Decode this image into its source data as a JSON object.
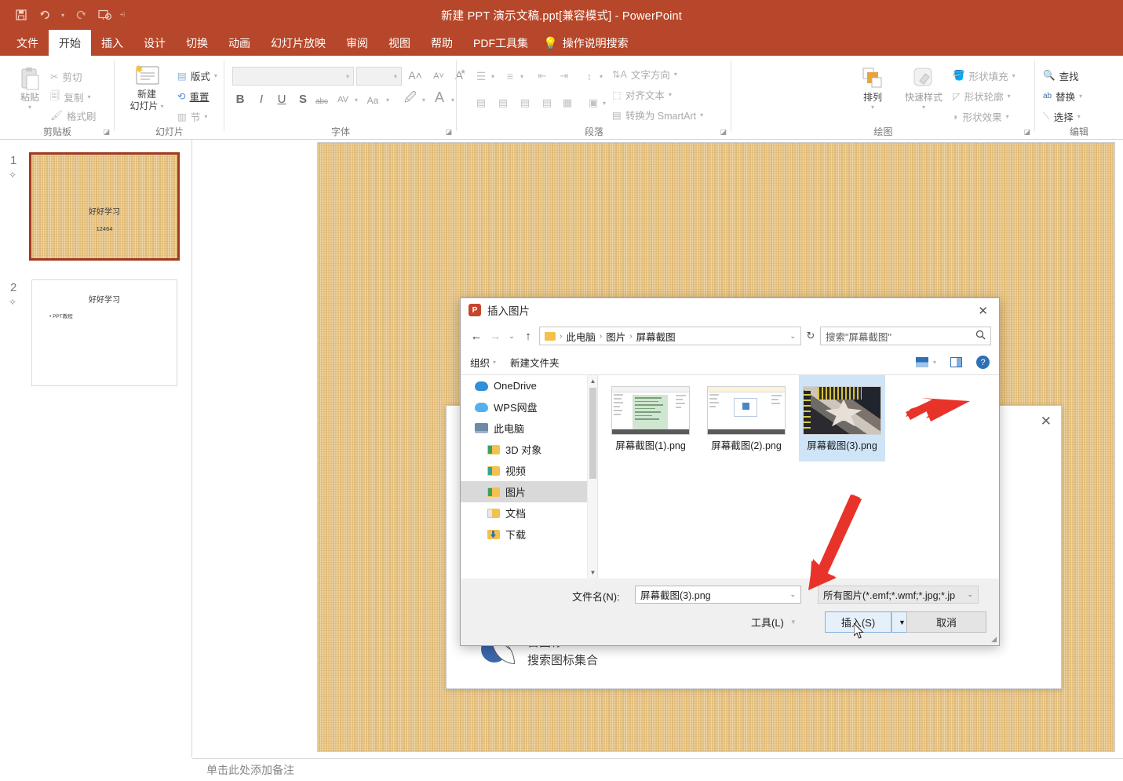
{
  "app": {
    "title": "新建 PPT 演示文稿.ppt[兼容模式]  -  PowerPoint",
    "accent": "#b7472a"
  },
  "quick_access": [
    {
      "name": "save",
      "glyph": "🖫"
    },
    {
      "name": "undo",
      "glyph": "↺"
    },
    {
      "name": "redo",
      "glyph": "↻"
    },
    {
      "name": "start-slideshow",
      "glyph": "🖵"
    }
  ],
  "tabs": [
    {
      "label": "文件",
      "active": false
    },
    {
      "label": "开始",
      "active": true
    },
    {
      "label": "插入",
      "active": false
    },
    {
      "label": "设计",
      "active": false
    },
    {
      "label": "切换",
      "active": false
    },
    {
      "label": "动画",
      "active": false
    },
    {
      "label": "幻灯片放映",
      "active": false
    },
    {
      "label": "审阅",
      "active": false
    },
    {
      "label": "视图",
      "active": false
    },
    {
      "label": "帮助",
      "active": false
    },
    {
      "label": "PDF工具集",
      "active": false
    }
  ],
  "tell_me": "操作说明搜索",
  "ribbon": {
    "clipboard": {
      "title": "剪贴板",
      "paste": "粘贴",
      "cut": "剪切",
      "copy": "复制",
      "format_painter": "格式刷"
    },
    "slides": {
      "title": "幻灯片",
      "new_slide": "新建\n幻灯片",
      "new_slide_l1": "新建",
      "new_slide_l2": "幻灯片",
      "layout": "版式",
      "reset": "重置",
      "section": "节"
    },
    "font": {
      "title": "字体",
      "font_name": "",
      "font_size": "",
      "bold": "B",
      "italic": "I",
      "underline": "U",
      "shadow": "S",
      "strikethrough": "abc",
      "char_spacing": "AV",
      "change_case": "Aa",
      "highlight": "🖍",
      "font_color": "A",
      "grow": "A",
      "shrink": "A",
      "clear_format": "A"
    },
    "paragraph": {
      "title": "段落",
      "text_direction": "文字方向",
      "align_text": "对齐文本",
      "convert_smartart": "转换为 SmartArt"
    },
    "drawing": {
      "title": "绘图",
      "arrange": "排列",
      "quick_styles": "快速样式",
      "shape_fill": "形状填充",
      "shape_outline": "形状轮廓",
      "shape_effects": "形状效果"
    },
    "editing": {
      "title": "编辑",
      "find": "查找",
      "replace": "替换",
      "select": "选择"
    }
  },
  "slides_panel": [
    {
      "number": "1",
      "star": "✧",
      "title": "好好学习",
      "subtitle": "12464",
      "selected": true,
      "textured": true
    },
    {
      "number": "2",
      "star": "✧",
      "title": "好好学习",
      "bullet": "• PPT教程",
      "selected": false,
      "textured": false
    }
  ],
  "background_dialog": {
    "title_partial": "自图标",
    "subtitle": "搜索图标集合",
    "close": "✕"
  },
  "dialog": {
    "title": "插入图片",
    "close": "✕",
    "nav": {
      "back": "←",
      "forward": "→",
      "recent": "⌄",
      "up": "↑"
    },
    "breadcrumb": [
      "此电脑",
      "图片",
      "屏幕截图"
    ],
    "breadcrumb_sep": "›",
    "refresh": "↻",
    "search_placeholder": "搜索\"屏幕截图\"",
    "search_icon": "🔍",
    "toolbar": {
      "organize": "组织",
      "new_folder": "新建文件夹",
      "view_icon": "view-options-icon",
      "preview_icon": "preview-pane-icon",
      "help": "?"
    },
    "sidebar": [
      {
        "label": "OneDrive",
        "icon": "cloud",
        "indent": false,
        "selected": false
      },
      {
        "label": "WPS网盘",
        "icon": "cloud-light",
        "indent": false,
        "selected": false
      },
      {
        "label": "此电脑",
        "icon": "pc",
        "indent": false,
        "selected": false
      },
      {
        "label": "3D 对象",
        "icon": "folder-green",
        "indent": true,
        "selected": false
      },
      {
        "label": "视频",
        "icon": "folder-teal",
        "indent": true,
        "selected": false
      },
      {
        "label": "图片",
        "icon": "folder-green",
        "indent": true,
        "selected": true
      },
      {
        "label": "文档",
        "icon": "folder-pale",
        "indent": true,
        "selected": false
      },
      {
        "label": "下载",
        "icon": "folder-download",
        "indent": true,
        "selected": false
      }
    ],
    "files": [
      {
        "name": "屏幕截图(1).png",
        "selected": false,
        "art": "doc-green"
      },
      {
        "name": "屏幕截图(2).png",
        "selected": false,
        "art": "doc-dialog"
      },
      {
        "name": "屏幕截图(3).png",
        "selected": true,
        "art": "photo"
      }
    ],
    "footer": {
      "filename_label": "文件名(N):",
      "filename_value": "屏幕截图(3).png",
      "filetype_value": "所有图片(*.emf;*.wmf;*.jpg;*.jp",
      "tools": "工具(L)",
      "insert": "插入(S)",
      "insert_caret": "▼",
      "cancel": "取消"
    }
  },
  "notes": {
    "placeholder": "单击此处添加备注"
  }
}
